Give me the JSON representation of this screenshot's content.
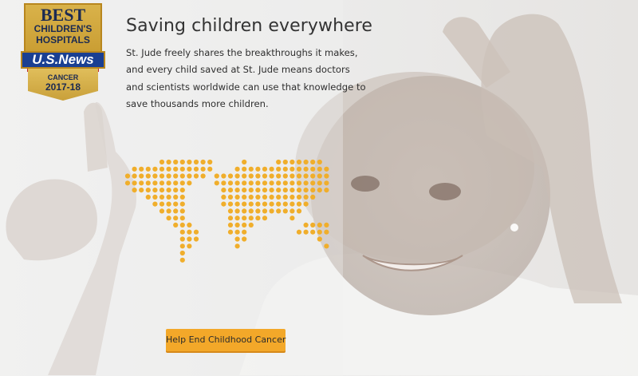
{
  "badge": {
    "line1": "BEST",
    "line2": "CHILDREN'S",
    "line3": "HOSPITALS",
    "brand": "U.S.News",
    "category": "CANCER",
    "years": "2017-18"
  },
  "headline": "Saving children everywhere",
  "body_lines": [
    "St. Jude freely shares the breakthroughs it makes,",
    "and every child saved at St. Jude means doctors",
    "and scientists worldwide can use that knowledge to",
    "save thousands more children."
  ],
  "cta_label": "Help End Childhood Cancer",
  "colors": {
    "dot": "#f0ae2b",
    "button": "#f3a829",
    "text": "#333333",
    "badge_gold": "#d9b24a",
    "badge_navy": "#1a3f92"
  },
  "icons": {
    "map": "world-map-dots-icon",
    "badge": "us-news-award-badge"
  }
}
